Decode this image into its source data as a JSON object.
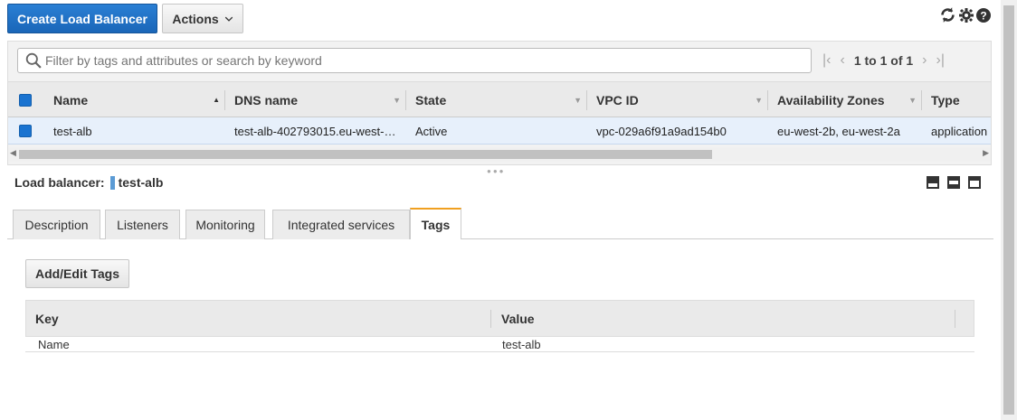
{
  "toolbar": {
    "create_label": "Create Load Balancer",
    "actions_label": "Actions"
  },
  "icons": [
    "refresh-icon",
    "gear-icon",
    "help-icon"
  ],
  "filter": {
    "placeholder": "Filter by tags and attributes or search by keyword",
    "pager_text": "1 to 1 of 1"
  },
  "table": {
    "columns": [
      "Name",
      "DNS name",
      "State",
      "VPC ID",
      "Availability Zones",
      "Type"
    ],
    "rows": [
      {
        "name": "test-alb",
        "dns": "test-alb-402793015.eu-west-…",
        "state": "Active",
        "vpc": "vpc-029a6f91a9ad154b0",
        "az": "eu-west-2b, eu-west-2a",
        "type": "application"
      }
    ]
  },
  "detail": {
    "label": "Load balancer:",
    "name": "test-alb",
    "tabs": [
      "Description",
      "Listeners",
      "Monitoring",
      "Integrated services",
      "Tags"
    ],
    "active_tab": "Tags"
  },
  "tags": {
    "button_label": "Add/Edit Tags",
    "headers": [
      "Key",
      "Value"
    ],
    "rows": [
      {
        "key": "Name",
        "value": "test-alb"
      }
    ]
  },
  "colors": {
    "primary": "#1a66b8",
    "selected_row": "#e7f0fb",
    "active_tab_accent": "#f0a020"
  }
}
